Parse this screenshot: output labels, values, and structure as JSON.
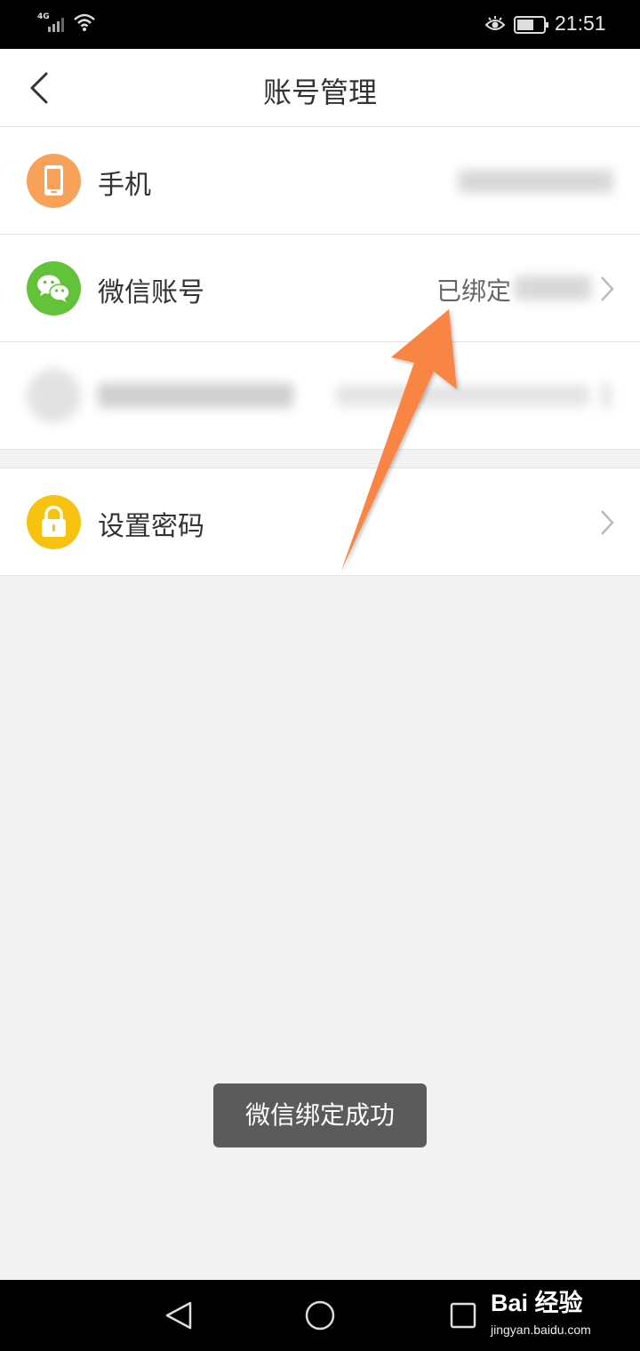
{
  "status_bar": {
    "network": "4G",
    "time": "21:51"
  },
  "header": {
    "title": "账号管理"
  },
  "rows": {
    "phone": {
      "label": "手机",
      "value": ""
    },
    "wechat": {
      "label": "微信账号",
      "value": "已绑定"
    },
    "hidden": {
      "label": "",
      "value": ""
    },
    "password": {
      "label": "设置密码"
    }
  },
  "toast": {
    "message": "微信绑定成功"
  },
  "watermark": {
    "logo": "Bai 经验",
    "url": "jingyan.baidu.com"
  },
  "colors": {
    "phone_icon": "#f8a159",
    "wechat_icon": "#62c33a",
    "password_icon": "#f7c310",
    "arrow": "#f98544",
    "background": "#f3f3f3"
  },
  "icons": {
    "back": "chevron-left-icon",
    "phone": "phone-icon",
    "wechat": "wechat-icon",
    "lock": "lock-icon"
  }
}
